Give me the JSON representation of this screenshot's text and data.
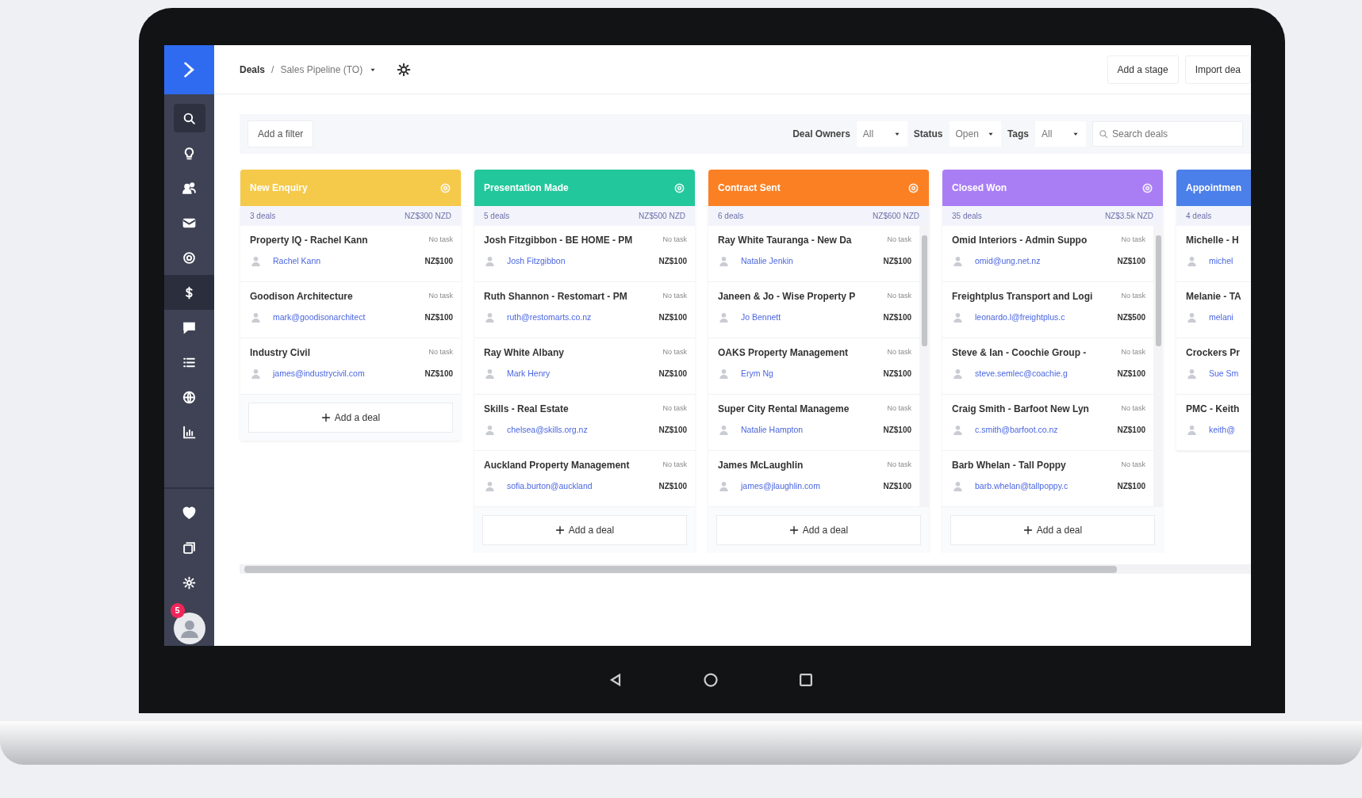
{
  "sidebar": {
    "badge": "5",
    "items": [
      {
        "kind": "search",
        "selected": false,
        "boxed": true
      },
      {
        "kind": "pin",
        "selected": false
      },
      {
        "kind": "people",
        "selected": false
      },
      {
        "kind": "envelope",
        "selected": false
      },
      {
        "kind": "target",
        "selected": false
      },
      {
        "kind": "dollar",
        "selected": true
      },
      {
        "kind": "chat",
        "selected": false
      },
      {
        "kind": "list",
        "selected": false
      },
      {
        "kind": "globe",
        "selected": false
      },
      {
        "kind": "chart",
        "selected": false
      }
    ],
    "bottom_items": [
      {
        "kind": "heart"
      },
      {
        "kind": "copy"
      },
      {
        "kind": "gear"
      }
    ]
  },
  "breadcrumb": {
    "root": "Deals",
    "separator": "/",
    "pipeline": "Sales Pipeline (TO)"
  },
  "header_buttons": [
    "Add a stage",
    "Import dea"
  ],
  "filters": {
    "add_filter": "Add a filter",
    "selects": [
      {
        "label": "Deal Owners",
        "value": "All"
      },
      {
        "label": "Status",
        "value": "Open"
      },
      {
        "label": "Tags",
        "value": "All"
      }
    ],
    "search": {
      "placeholder": "Search deals"
    }
  },
  "stages": [
    {
      "name": "New Enquiry",
      "color": "#f5c94a",
      "count": "3 deals",
      "total": "NZ$300 NZD",
      "add_label": "Add a deal",
      "deals": [
        {
          "title": "Property IQ - Rachel Kann",
          "task": "No task",
          "contact": "Rachel Kann",
          "amount": "NZ$100"
        },
        {
          "title": "Goodison Architecture",
          "task": "No task",
          "contact": "mark@goodisonarchitect",
          "amount": "NZ$100"
        },
        {
          "title": "Industry Civil",
          "task": "No task",
          "contact": "james@industrycivil.com",
          "amount": "NZ$100"
        }
      ]
    },
    {
      "name": "Presentation Made",
      "color": "#22c79b",
      "count": "5 deals",
      "total": "NZ$500 NZD",
      "add_label": "Add a deal",
      "deals": [
        {
          "title": "Josh Fitzgibbon - BE HOME - PM",
          "task": "No task",
          "contact": "Josh Fitzgibbon",
          "amount": "NZ$100"
        },
        {
          "title": "Ruth Shannon - Restomart - PM",
          "task": "No task",
          "contact": "ruth@restomarts.co.nz",
          "amount": "NZ$100"
        },
        {
          "title": "Ray White Albany",
          "task": "No task",
          "contact": "Mark Henry",
          "amount": "NZ$100"
        },
        {
          "title": "Skills - Real Estate",
          "task": "No task",
          "contact": "chelsea@skills.org.nz",
          "amount": "NZ$100"
        },
        {
          "title": "Auckland Property Management",
          "task": "No task",
          "contact": "sofia.burton@auckland",
          "amount": "NZ$100"
        }
      ]
    },
    {
      "name": "Contract Sent",
      "color": "#fb8024",
      "count": "6 deals",
      "total": "NZ$600 NZD",
      "scrollbar": true,
      "add_label": "Add a deal",
      "deals": [
        {
          "title": "Ray White Tauranga - New Da",
          "task": "No task",
          "contact": "Natalie Jenkin",
          "amount": "NZ$100"
        },
        {
          "title": "Janeen & Jo - Wise Property P",
          "task": "No task",
          "contact": "Jo Bennett",
          "amount": "NZ$100"
        },
        {
          "title": "OAKS Property Management",
          "task": "No task",
          "contact": "Erym Ng",
          "amount": "NZ$100"
        },
        {
          "title": "Super City Rental Manageme",
          "task": "No task",
          "contact": "Natalie Hampton",
          "amount": "NZ$100"
        },
        {
          "title": "James McLaughlin",
          "task": "No task",
          "contact": "james@jlaughlin.com",
          "amount": "NZ$100"
        }
      ]
    },
    {
      "name": "Closed Won",
      "color": "#a97ef5",
      "count": "35 deals",
      "total": "NZ$3.5k NZD",
      "scrollbar": true,
      "add_label": "Add a deal",
      "deals": [
        {
          "title": "Omid Interiors - Admin Suppo",
          "task": "No task",
          "contact": "omid@ung.net.nz",
          "amount": "NZ$100"
        },
        {
          "title": "Freightplus Transport and Logi",
          "task": "No task",
          "contact": "leonardo.l@freightplus.c",
          "amount": "NZ$500"
        },
        {
          "title": "Steve & Ian - Coochie Group -",
          "task": "No task",
          "contact": "steve.semlec@coachie.g",
          "amount": "NZ$100"
        },
        {
          "title": "Craig Smith - Barfoot New Lyn",
          "task": "No task",
          "contact": "c.smith@barfoot.co.nz",
          "amount": "NZ$100"
        },
        {
          "title": "Barb Whelan - Tall Poppy",
          "task": "No task",
          "contact": "barb.whelan@tallpoppy.c",
          "amount": "NZ$100"
        }
      ]
    },
    {
      "name": "Appointmen",
      "color": "#4b7fe9",
      "count": "4 deals",
      "deals": [
        {
          "title": "Michelle - H",
          "contact": "michel"
        },
        {
          "title": "Melanie - TA",
          "contact": "melani"
        },
        {
          "title": "Crockers Pr",
          "contact": "Sue Sm"
        },
        {
          "title": "PMC - Keith",
          "contact": "keith@"
        }
      ]
    }
  ]
}
